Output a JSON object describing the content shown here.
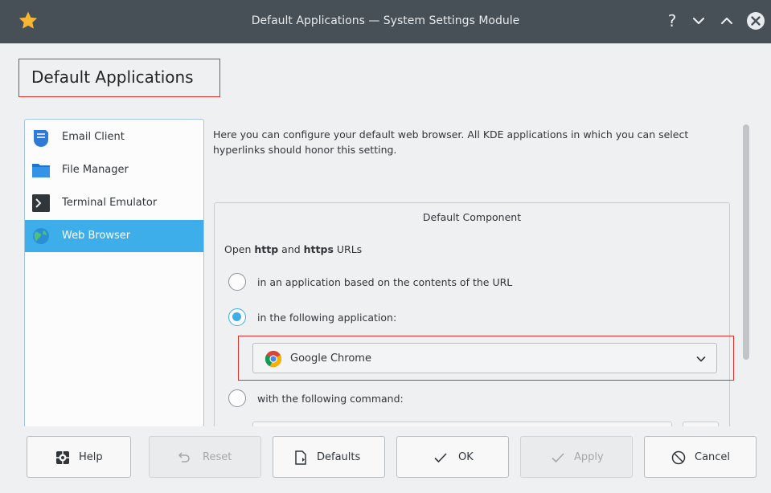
{
  "window": {
    "title": "Default Applications — System Settings Module",
    "help_glyph": "?"
  },
  "page": {
    "heading": "Default Applications"
  },
  "sidebar": {
    "items": [
      {
        "label": "Email Client",
        "icon": "email-icon",
        "selected": false
      },
      {
        "label": "File Manager",
        "icon": "folder-icon",
        "selected": false
      },
      {
        "label": "Terminal Emulator",
        "icon": "terminal-icon",
        "selected": false
      },
      {
        "label": "Web Browser",
        "icon": "globe-icon",
        "selected": true
      }
    ]
  },
  "content": {
    "description": "Here you can configure your default web browser. All KDE applications in which you can select hyperlinks should honor this setting.",
    "group_title": "Default Component",
    "open_label": {
      "prefix": "Open ",
      "http": "http",
      "and": " and ",
      "https": "https",
      "suffix": " URLs"
    },
    "options": [
      {
        "label": "in an application based on the contents of the URL",
        "checked": false
      },
      {
        "label": "in the following application:",
        "checked": true
      },
      {
        "label": "with the following command:",
        "checked": false
      }
    ],
    "browser_select": {
      "value": "Google Chrome",
      "icon": "chrome-icon"
    }
  },
  "buttons": {
    "help": "Help",
    "reset": "Reset",
    "defaults": "Defaults",
    "ok": "OK",
    "apply": "Apply",
    "cancel": "Cancel"
  },
  "colors": {
    "titlebar": "#475057",
    "accent": "#3daee9",
    "highlight_box": "#e0302b"
  }
}
